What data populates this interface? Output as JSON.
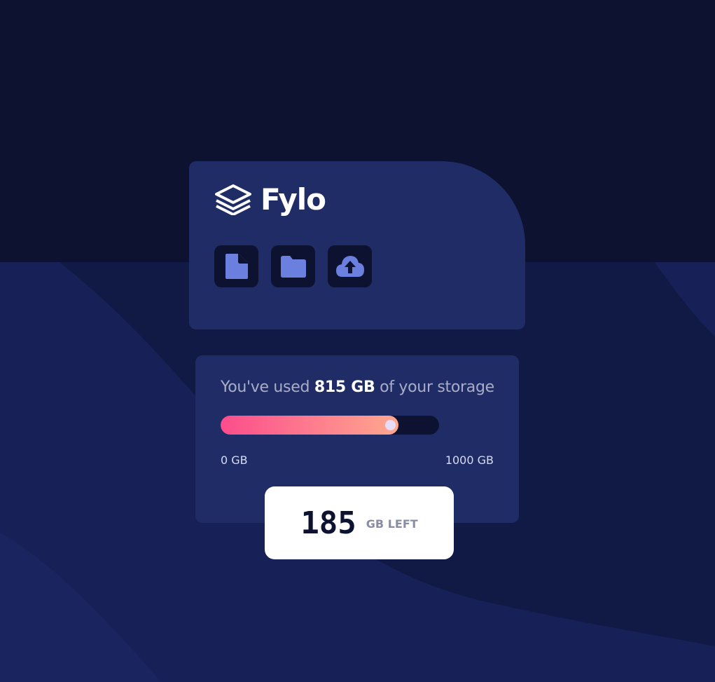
{
  "brand": {
    "name": "Fylo",
    "logo_icon": "layers-icon"
  },
  "actions": [
    {
      "name": "file",
      "icon": "file-icon"
    },
    {
      "name": "folder",
      "icon": "folder-icon"
    },
    {
      "name": "upload",
      "icon": "upload-icon"
    }
  ],
  "storage": {
    "usage_prefix": "You've used ",
    "used_value": "815 GB",
    "usage_suffix": " of your storage",
    "used_fraction": 0.815,
    "scale_min": "0 GB",
    "scale_max": "1000 GB",
    "remaining_value": "185",
    "remaining_unit": "GB LEFT"
  },
  "colors": {
    "background": "#0c1230",
    "card": "#1f2c66",
    "icon_fill": "#6a7fde",
    "gradient_start": "#fc4d8c",
    "gradient_end": "#ffa88f",
    "text_muted": "#a9adc9"
  }
}
